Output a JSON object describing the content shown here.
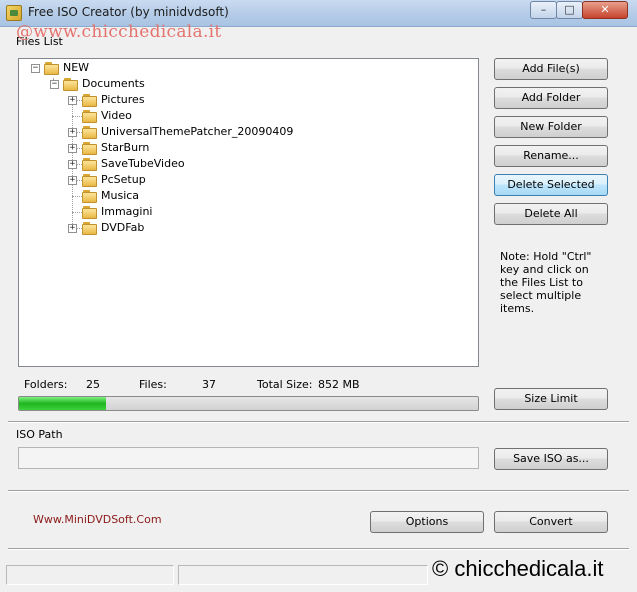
{
  "window": {
    "title": "Free ISO Creator (by minidvdsoft)",
    "controls": {
      "minimize": "–",
      "maximize": "□",
      "close": "✕"
    }
  },
  "watermark_top": "@www.chicchedicala.it",
  "files_list": {
    "section_label": "Files List",
    "tree": [
      {
        "label": "NEW",
        "expander": "−"
      },
      {
        "label": "Documents",
        "expander": "−"
      },
      {
        "label": "Pictures",
        "expander": "+"
      },
      {
        "label": "Video",
        "expander": ""
      },
      {
        "label": "UniversalThemePatcher_20090409",
        "expander": "+"
      },
      {
        "label": "StarBurn",
        "expander": "+"
      },
      {
        "label": "SaveTubeVideo",
        "expander": "+"
      },
      {
        "label": "PcSetup",
        "expander": "+"
      },
      {
        "label": "Musica",
        "expander": ""
      },
      {
        "label": "Immagini",
        "expander": ""
      },
      {
        "label": "DVDFab",
        "expander": "+"
      }
    ]
  },
  "buttons": {
    "add_files": "Add File(s)",
    "add_folder": "Add Folder",
    "new_folder": "New Folder",
    "rename": "Rename...",
    "delete_selected": "Delete Selected",
    "delete_all": "Delete All",
    "size_limit": "Size Limit",
    "save_iso": "Save ISO as...",
    "options": "Options",
    "convert": "Convert"
  },
  "note": "Note: Hold \"Ctrl\" key and click on the Files List to select multiple items.",
  "stats": {
    "folders_label": "Folders:",
    "folders_value": "25",
    "files_label": "Files:",
    "files_value": "37",
    "total_size_label": "Total Size:",
    "total_size_value": "852 MB"
  },
  "progress": {
    "fraction": 0.19,
    "fill_color": "#28c228"
  },
  "iso_path": {
    "section_label": "ISO Path",
    "value": ""
  },
  "website": "Www.MiniDVDSoft.Com",
  "copyright": "© chicchedicala.it",
  "colors": {
    "titlebar": "#b6cde8",
    "focus_button": "#bee6fd",
    "website_text": "#8b1a1a",
    "watermark": "#e4736e"
  }
}
